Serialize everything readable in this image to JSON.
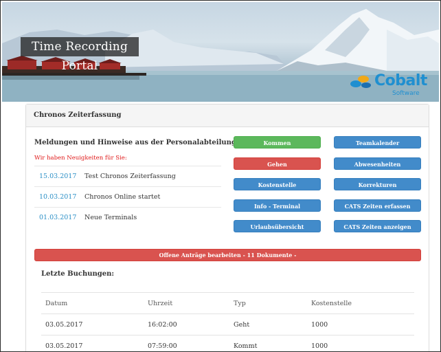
{
  "header": {
    "title": "Time Recording Portal",
    "logo": {
      "name": "Cobalt",
      "sub": "Software"
    }
  },
  "panel": {
    "title": "Chronos Zeiterfassung",
    "news_title": "Meldungen und Hinweise aus der Personalabteilung",
    "news_subtitle": "Wir haben Neuigkeiten für Sie:",
    "news": [
      {
        "date": "15.03.2017",
        "text": "Test Chronos Zeiterfassung"
      },
      {
        "date": "10.03.2017",
        "text": "Chronos Online startet"
      },
      {
        "date": "01.03.2017",
        "text": "Neue Terminals"
      }
    ],
    "buttons": {
      "kommen": "Kommen",
      "gehen": "Gehen",
      "kostenstelle": "Kostenstelle",
      "info_terminal": "Info - Terminal",
      "urlaubsuebersicht": "Urlaubsübersicht",
      "teamkalender": "Teamkalender",
      "abwesenheiten": "Abwesenheiten",
      "korrekturen": "Korrekturen",
      "cats_erfassen": "CATS Zeiten erfassen",
      "cats_anzeigen": "CATS Zeiten anzeigen"
    },
    "open_requests": "Offene Anträge bearbeiten - 11 Dokumente -",
    "bookings_title": "Letzte Buchungen:",
    "table": {
      "headers": [
        "Datum",
        "Uhrzeit",
        "Typ",
        "Kostenstelle"
      ],
      "rows": [
        [
          "03.05.2017",
          "16:02:00",
          "Geht",
          "1000"
        ],
        [
          "03.05.2017",
          "07:59:00",
          "Kommt",
          "1000"
        ]
      ]
    }
  },
  "colors": {
    "green": "#5cb85c",
    "red": "#d9534f",
    "blue": "#428bca",
    "news_date": "#2a8fc6",
    "news_subtitle": "#e01a1a"
  }
}
